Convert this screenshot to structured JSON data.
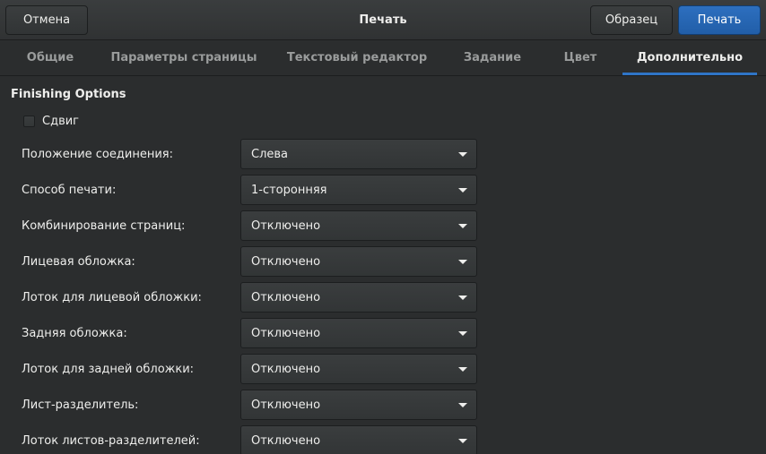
{
  "header": {
    "title": "Печать",
    "cancel_label": "Отмена",
    "preview_label": "Образец",
    "print_label": "Печать"
  },
  "tabs": [
    {
      "label": "Общие",
      "active": false
    },
    {
      "label": "Параметры страницы",
      "active": false
    },
    {
      "label": "Текстовый редактор",
      "active": false
    },
    {
      "label": "Задание",
      "active": false
    },
    {
      "label": "Цвет",
      "active": false
    },
    {
      "label": "Дополнительно",
      "active": true
    }
  ],
  "content": {
    "section_title": "Finishing Options",
    "shift_checkbox": {
      "label": "Сдвиг",
      "checked": false
    },
    "options": [
      {
        "label": "Положение соединения:",
        "value": "Слева"
      },
      {
        "label": "Способ печати:",
        "value": "1-сторонняя"
      },
      {
        "label": "Комбинирование страниц:",
        "value": "Отключено"
      },
      {
        "label": "Лицевая обложка:",
        "value": "Отключено"
      },
      {
        "label": "Лоток для лицевой обложки:",
        "value": "Отключено"
      },
      {
        "label": "Задняя обложка:",
        "value": "Отключено"
      },
      {
        "label": "Лоток для задней обложки:",
        "value": "Отключено"
      },
      {
        "label": "Лист-разделитель:",
        "value": "Отключено"
      },
      {
        "label": "Лоток листов-разделителей:",
        "value": "Отключено"
      }
    ]
  },
  "colors": {
    "accent": "#2f74c6",
    "print_button": "#215ea8",
    "background": "#2b2d2e"
  }
}
